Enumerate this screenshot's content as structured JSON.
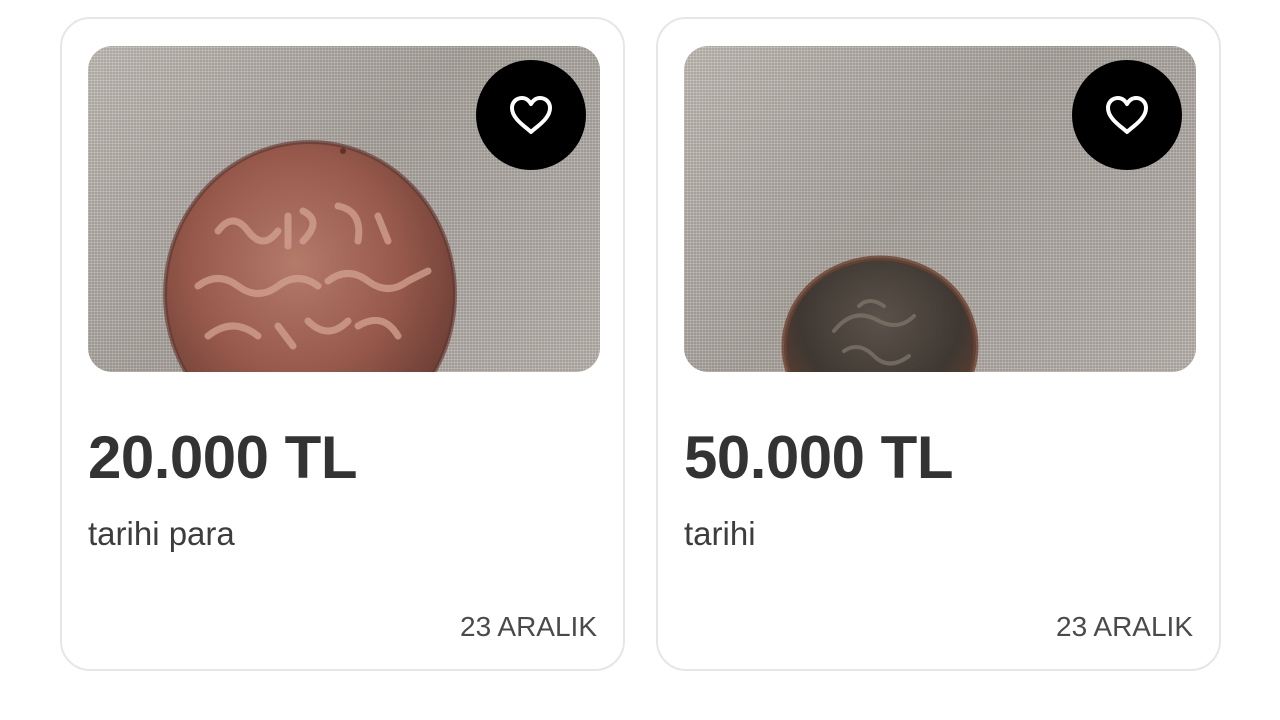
{
  "listings": [
    {
      "price": "20.000 TL",
      "title": "tarihi para",
      "date": "23 ARALIK",
      "photo": "copper-coin-on-fabric",
      "favorite_icon": "heart-outline-icon"
    },
    {
      "price": "50.000 TL",
      "title": "tarihi",
      "date": "23 ARALIK",
      "photo": "dark-bronze-coin-on-fabric",
      "favorite_icon": "heart-outline-icon"
    }
  ],
  "colors": {
    "price_text": "#333333",
    "secondary_text": "#3d3d3d",
    "card_border": "#e6e6e6",
    "favorite_bg": "#000000"
  }
}
